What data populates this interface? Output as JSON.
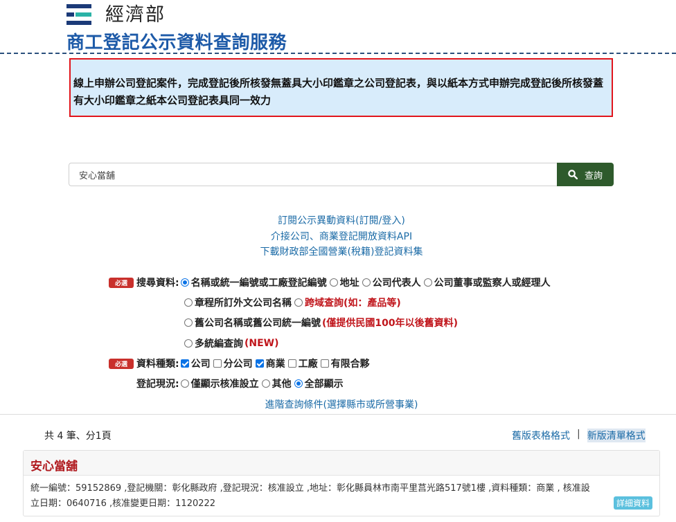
{
  "header": {
    "ministry": "經濟部",
    "site_title": "商工登記公示資料查詢服務"
  },
  "notice": "線上申辦公司登記案件，完成登記後所核發無蓋具大小印鑑章之公司登記表，與以紙本方式申辦完成登記後所核發蓋有大小印鑑章之紙本公司登記表具同一效力",
  "search": {
    "value": "安心當舖",
    "button_label": "查詢"
  },
  "links": [
    "訂閱公示異動資料(訂閱/登入)",
    "介接公司、商業登記開放資料API",
    "下載財政部全國營業(稅籍)登記資料集"
  ],
  "form": {
    "required_badge": "必選",
    "search_field": {
      "label": "搜尋資料:",
      "options": [
        {
          "label": "名稱或統一編號或工廠登記編號",
          "selected": true
        },
        {
          "label": "地址",
          "selected": false
        },
        {
          "label": "公司代表人",
          "selected": false
        },
        {
          "label": "公司董事或監察人或經理人",
          "selected": false
        },
        {
          "label": "章程所訂外文公司名稱",
          "selected": false
        },
        {
          "label": "跨域查詢(如：產品等)",
          "selected": false
        },
        {
          "label": "舊公司名稱或舊公司統一編號",
          "note": "(僅提供民國100年以後舊資料)",
          "selected": false
        },
        {
          "label": "多統編查詢",
          "note": "(NEW)",
          "selected": false
        }
      ]
    },
    "data_type": {
      "label": "資料種類:",
      "options": [
        {
          "label": "公司",
          "checked": true
        },
        {
          "label": "分公司",
          "checked": false
        },
        {
          "label": "商業",
          "checked": true
        },
        {
          "label": "工廠",
          "checked": false
        },
        {
          "label": "有限合夥",
          "checked": false
        }
      ]
    },
    "status": {
      "label": "登記現況:",
      "options": [
        {
          "label": "僅顯示核准設立",
          "selected": false
        },
        {
          "label": "其他",
          "selected": false
        },
        {
          "label": "全部顯示",
          "selected": true
        }
      ]
    },
    "advanced_link": "進階查詢條件(選擇縣市或所營事業)"
  },
  "results": {
    "count_text": "共 4 筆、分1頁",
    "view_old": "舊版表格格式",
    "view_sep": "|",
    "view_new": "新版清單格式",
    "items": [
      {
        "name": "安心當舖",
        "line1": "統一編號：59152869 ,登記機關：彰化縣政府 ,登記現況：核准設立 ,地址：彰化縣員林市南平里莒光路517號1樓 ,資料種類：商業 , 核准設",
        "line2": "立日期：0640716 ,核准變更日期：1120222",
        "detail_label": "詳細資料"
      }
    ]
  },
  "colors": {
    "title_blue": "#1d5aa8",
    "notice_bg": "#d8ecfb",
    "notice_border": "#e1141b",
    "search_button": "#2e5a2c",
    "required_badge": "#c9302c",
    "link": "#1a6aa6",
    "result_name": "#b0191e"
  }
}
